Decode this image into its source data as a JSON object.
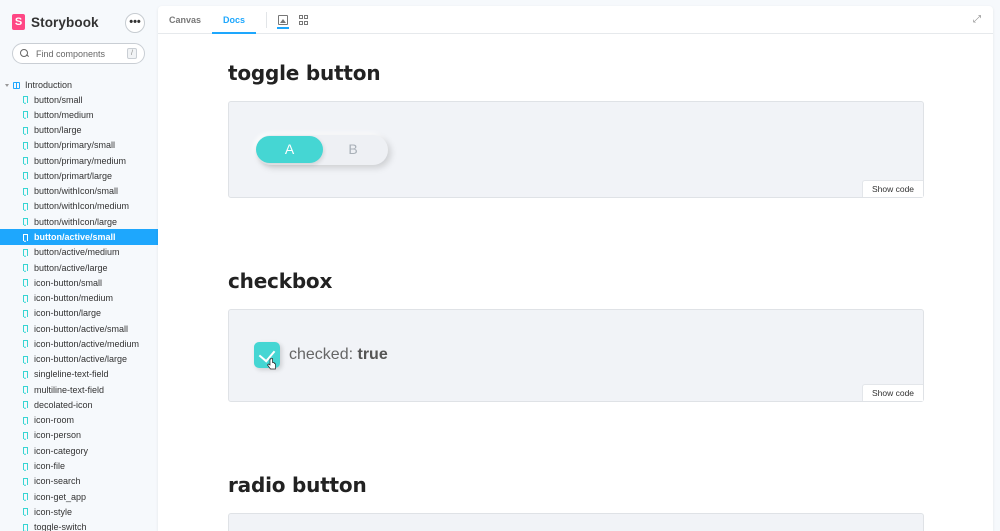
{
  "app": {
    "name": "Storybook",
    "logo_letter": "S",
    "menu_glyph": "•••"
  },
  "search": {
    "placeholder": "Find components",
    "shortcut": "/"
  },
  "sidebar": {
    "root": "Introduction",
    "items": [
      "button/small",
      "button/medium",
      "button/large",
      "button/primary/small",
      "button/primary/medium",
      "button/primart/large",
      "button/withIcon/small",
      "button/withIcon/medium",
      "button/withIcon/large",
      "button/active/small",
      "button/active/medium",
      "button/active/large",
      "icon-button/small",
      "icon-button/medium",
      "icon-button/large",
      "icon-button/active/small",
      "icon-button/active/medium",
      "icon-button/active/large",
      "singleline-text-field",
      "multiline-text-field",
      "decolated-icon",
      "icon-room",
      "icon-person",
      "icon-category",
      "icon-file",
      "icon-search",
      "icon-get_app",
      "icon-style",
      "toggle-switch"
    ],
    "active_index": 9
  },
  "toolbar": {
    "tabs": [
      "Canvas",
      "Docs"
    ],
    "active_tab": "Docs"
  },
  "sections": [
    {
      "title": "toggle button",
      "show_code": "Show code",
      "toggle": {
        "a": "A",
        "b": "B",
        "selected": "A"
      }
    },
    {
      "title": "checkbox",
      "show_code": "Show code",
      "checkbox": {
        "label": "checked:",
        "value": "true"
      }
    },
    {
      "title": "radio button"
    }
  ],
  "colors": {
    "accent": "#1ea7fd",
    "brand": "#ff4785",
    "teal": "#45d6d3"
  }
}
